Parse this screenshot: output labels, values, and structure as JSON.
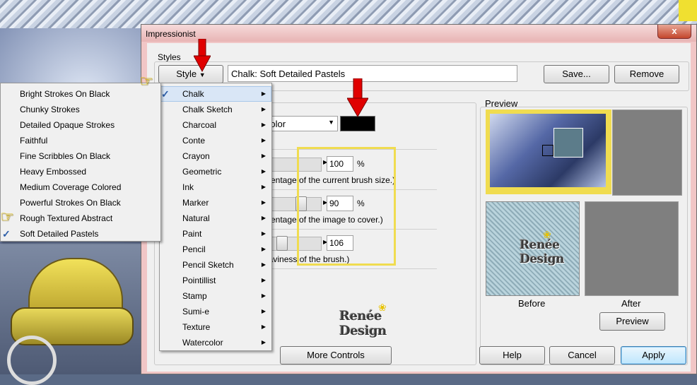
{
  "window": {
    "title": "Impressionist",
    "close": "x"
  },
  "styles": {
    "group_label": "Styles",
    "style_button": "Style",
    "current_style": "Chalk: Soft Detailed Pastels",
    "save_button": "Save...",
    "remove_button": "Remove"
  },
  "controls": {
    "color_select": "Color",
    "color_swatch": "#000000",
    "rows": [
      {
        "value": "100",
        "unit": "%",
        "desc": "rcentage of the current brush size.)"
      },
      {
        "value": "90",
        "unit": "%",
        "desc": "rcentage of the image to cover.)"
      },
      {
        "value": "106",
        "unit": "",
        "desc": "eaviness of the brush.)"
      }
    ]
  },
  "preview": {
    "group_label": "Preview",
    "before_label": "Before",
    "after_label": "After",
    "preview_button": "Preview"
  },
  "logo_text": "Renée Design",
  "buttons": {
    "more_controls": "More Controls",
    "help": "Help",
    "cancel": "Cancel",
    "apply": "Apply"
  },
  "style_menu": {
    "items": [
      {
        "label": "Chalk",
        "checked": true
      },
      {
        "label": "Chalk Sketch"
      },
      {
        "label": "Charcoal"
      },
      {
        "label": "Conte"
      },
      {
        "label": "Crayon"
      },
      {
        "label": "Geometric"
      },
      {
        "label": "Ink"
      },
      {
        "label": "Marker"
      },
      {
        "label": "Natural"
      },
      {
        "label": "Paint"
      },
      {
        "label": "Pencil"
      },
      {
        "label": "Pencil Sketch"
      },
      {
        "label": "Pointillist"
      },
      {
        "label": "Stamp"
      },
      {
        "label": "Sumi-e"
      },
      {
        "label": "Texture"
      },
      {
        "label": "Watercolor"
      }
    ]
  },
  "chalk_submenu": {
    "items": [
      {
        "label": "Bright Strokes On Black"
      },
      {
        "label": "Chunky Strokes"
      },
      {
        "label": "Detailed Opaque Strokes"
      },
      {
        "label": "Faithful"
      },
      {
        "label": "Fine Scribbles On Black"
      },
      {
        "label": "Heavy Embossed"
      },
      {
        "label": "Medium Coverage Colored"
      },
      {
        "label": "Powerful Strokes On Black"
      },
      {
        "label": "Rough Textured Abstract"
      },
      {
        "label": "Soft Detailed Pastels",
        "checked": true
      }
    ]
  },
  "colors": {
    "highlight_box": "#f0dc50",
    "arrow": "#e00000",
    "check": "#2d5ea8"
  }
}
